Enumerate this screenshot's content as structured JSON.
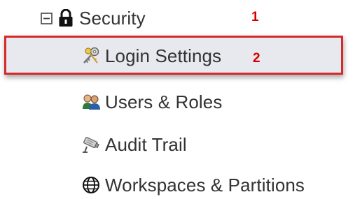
{
  "tree": {
    "parent": {
      "label": "Security",
      "expanded": true,
      "toggle_icon": "collapse-box-icon",
      "icon": "lock-icon"
    },
    "children": [
      {
        "label": "Login Settings",
        "icon": "keys-icon",
        "selected": true
      },
      {
        "label": "Users & Roles",
        "icon": "users-icon",
        "selected": false
      },
      {
        "label": "Audit Trail",
        "icon": "camera-icon",
        "selected": false
      },
      {
        "label": "Workspaces & Partitions",
        "icon": "globe-icon",
        "selected": false
      }
    ]
  },
  "annotations": {
    "step_1": "1",
    "step_2": "2"
  },
  "colors": {
    "highlight_border": "#d42a2a",
    "step_number": "#d10000",
    "selected_bg": "#e8e8ef"
  }
}
